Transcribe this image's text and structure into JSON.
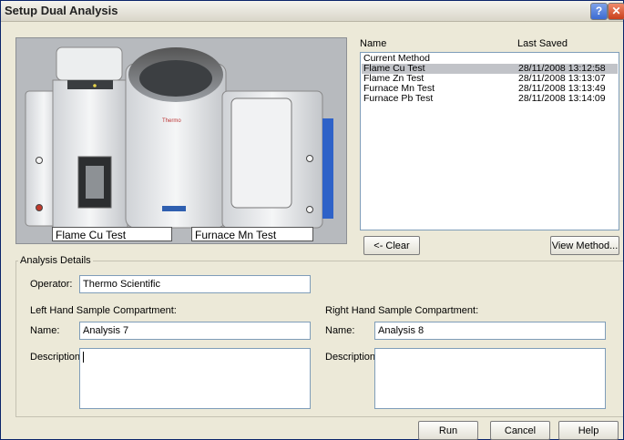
{
  "window": {
    "title": "Setup Dual Analysis",
    "help_glyph": "?",
    "close_glyph": "✕"
  },
  "instrument_image": {
    "brand": "Thermo",
    "left_caption": "Flame Cu Test",
    "right_caption": "Furnace Mn Test"
  },
  "methods": {
    "col_name": "Name",
    "col_saved": "Last Saved",
    "rows": [
      {
        "name": "Current Method",
        "saved": ""
      },
      {
        "name": "Flame Cu Test",
        "saved": "28/11/2008 13:12:58"
      },
      {
        "name": "Flame Zn Test",
        "saved": "28/11/2008 13:13:07"
      },
      {
        "name": "Furnace Mn Test",
        "saved": "28/11/2008 13:13:49"
      },
      {
        "name": "Furnace Pb Test",
        "saved": "28/11/2008 13:14:09"
      }
    ],
    "selected_index": 1
  },
  "buttons": {
    "clear": "<- Clear",
    "view_method": "View Method...",
    "run": "Run",
    "cancel": "Cancel",
    "help": "Help"
  },
  "analysis": {
    "group_label": "Analysis Details",
    "operator_label": "Operator:",
    "operator_value": "Thermo Scientific",
    "left_heading": "Left Hand Sample Compartment:",
    "right_heading": "Right Hand Sample Compartment:",
    "name_label": "Name:",
    "description_label": "Description:",
    "left_name": "Analysis 7",
    "right_name": "Analysis 8",
    "left_description": "",
    "right_description": ""
  },
  "colors": {
    "dialog_bg": "#ece9d8",
    "selection": "#c1c3c8",
    "field_border": "#7f9db9"
  }
}
